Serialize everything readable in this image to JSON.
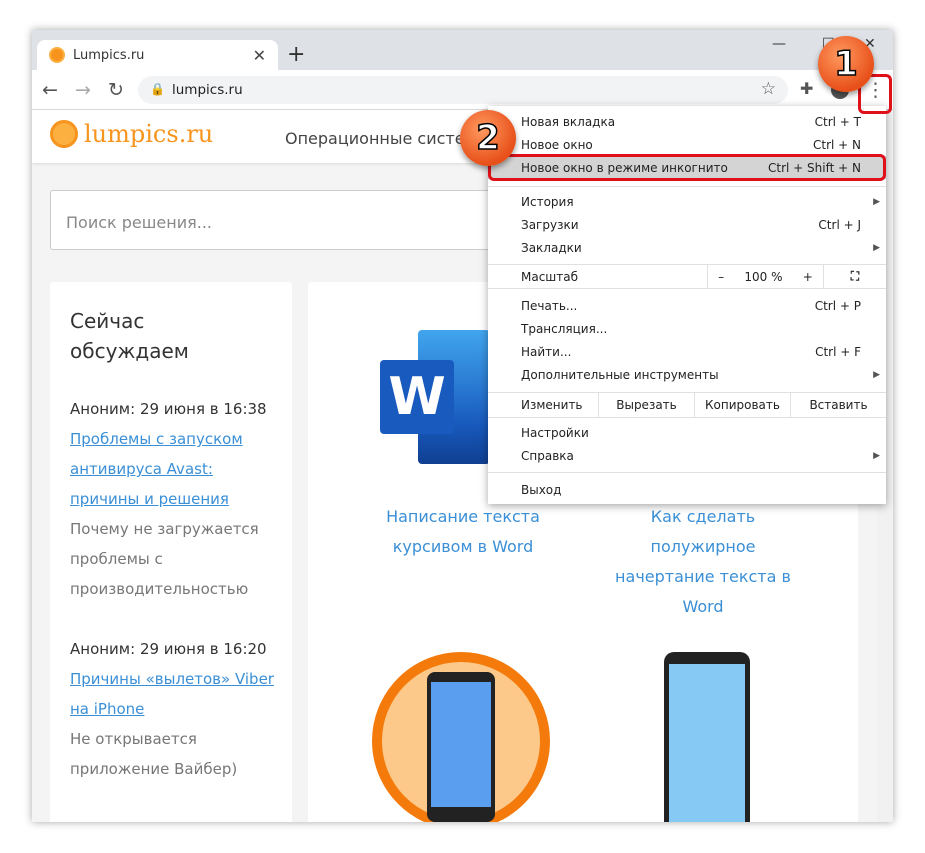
{
  "browser": {
    "tab_title": "Lumpics.ru",
    "url": "lumpics.ru"
  },
  "site": {
    "logo": "lumpics.ru",
    "nav_item": "Операционные систем",
    "search_placeholder": "Поиск решения...",
    "sidebar": {
      "title": "Сейчас обсуждаем",
      "comments": [
        {
          "author": "Аноним: 29 июня в 16:38",
          "link": "Проблемы с запуском антивируса Avast: причины и решения",
          "text": "Почему не загружается проблемы с производительностью"
        },
        {
          "author": "Аноним: 29 июня в 16:20",
          "link": "Причины «вылетов» Viber на iPhone",
          "text": "Не открывается приложение Вайбер)"
        }
      ]
    },
    "articles": [
      {
        "title": "Написание текста курсивом в Word"
      },
      {
        "title": "Как сделать полужирное начертание текста в Word"
      }
    ]
  },
  "menu": {
    "items": [
      {
        "label": "Новая вкладка",
        "shortcut": "Ctrl + T"
      },
      {
        "label": "Новое окно",
        "shortcut": "Ctrl + N"
      },
      {
        "label": "Новое окно в режиме инкогнито",
        "shortcut": "Ctrl + Shift + N"
      },
      {
        "label": "История",
        "shortcut": ""
      },
      {
        "label": "Загрузки",
        "shortcut": "Ctrl + J"
      },
      {
        "label": "Закладки",
        "shortcut": ""
      },
      {
        "label": "Печать...",
        "shortcut": "Ctrl + P"
      },
      {
        "label": "Трансляция...",
        "shortcut": ""
      },
      {
        "label": "Найти...",
        "shortcut": "Ctrl + F"
      },
      {
        "label": "Дополнительные инструменты",
        "shortcut": ""
      },
      {
        "label": "Настройки",
        "shortcut": ""
      },
      {
        "label": "Справка",
        "shortcut": ""
      },
      {
        "label": "Выход",
        "shortcut": ""
      }
    ],
    "zoom": {
      "label": "Масштаб",
      "minus": "–",
      "value": "100 %",
      "plus": "+"
    },
    "edit": {
      "label": "Изменить",
      "cut": "Вырезать",
      "copy": "Копировать",
      "paste": "Вставить"
    }
  },
  "annotations": {
    "step1": "1",
    "step2": "2",
    "highlight_color": "#e0101a"
  }
}
